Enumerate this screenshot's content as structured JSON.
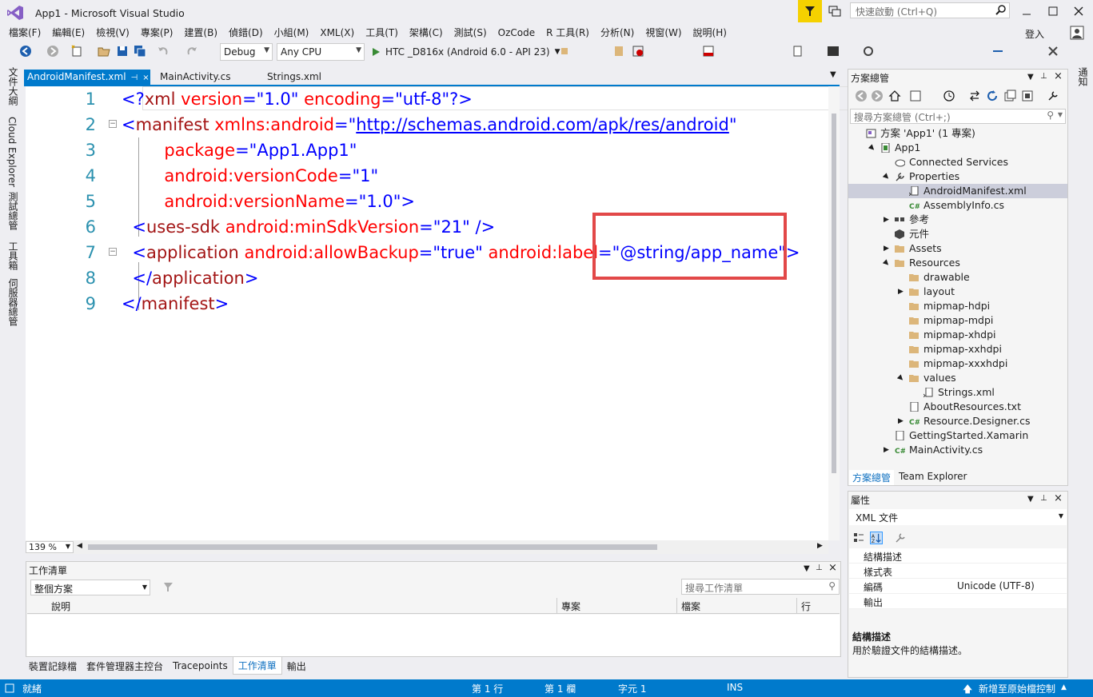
{
  "window": {
    "title": "App1 - Microsoft Visual Studio",
    "quick_launch_placeholder": "快速啟動 (Ctrl+Q)",
    "login": "登入"
  },
  "menu": [
    "檔案(F)",
    "編輯(E)",
    "檢視(V)",
    "專案(P)",
    "建置(B)",
    "偵錯(D)",
    "小組(M)",
    "XML(X)",
    "工具(T)",
    "架構(C)",
    "測試(S)",
    "OzCode",
    "R 工具(R)",
    "分析(N)",
    "視窗(W)",
    "說明(H)"
  ],
  "toolbar": {
    "config": "Debug",
    "platform": "Any CPU",
    "run_target": "HTC _D816x (Android 6.0 - API 23)"
  },
  "left_tabs": [
    "文件大綱",
    "Cloud Explorer",
    "測試總管",
    "工具箱",
    "伺服器總管"
  ],
  "right_tabs": [
    "通知"
  ],
  "doc_tabs": [
    "AndroidManifest.xml",
    "MainActivity.cs",
    "Strings.xml"
  ],
  "editor": {
    "lines": [
      {
        "n": "1",
        "fold": "",
        "parts": [
          [
            "<?",
            "blue"
          ],
          [
            "xml",
            "brown"
          ],
          [
            " version",
            "red"
          ],
          [
            "=",
            "blue"
          ],
          [
            "\"1.0\"",
            "black"
          ],
          [
            " encoding",
            "red"
          ],
          [
            "=",
            "blue"
          ],
          [
            "\"utf-8\"",
            "black"
          ],
          [
            "?>",
            "blue"
          ]
        ]
      },
      {
        "n": "2",
        "fold": "−",
        "parts": [
          [
            "<",
            "blue"
          ],
          [
            "manifest",
            "brown"
          ],
          [
            " xmlns:android",
            "red"
          ],
          [
            "=",
            "blue"
          ],
          [
            "\"",
            "black"
          ],
          [
            "http://schemas.android.com/apk/res/android",
            "link"
          ],
          [
            "\"",
            "black"
          ]
        ]
      },
      {
        "n": "3",
        "fold": "",
        "parts": [
          [
            "        package",
            "red"
          ],
          [
            "=",
            "blue"
          ],
          [
            "\"App1.App1\"",
            "black"
          ]
        ]
      },
      {
        "n": "4",
        "fold": "",
        "parts": [
          [
            "        android:versionCode",
            "red"
          ],
          [
            "=",
            "blue"
          ],
          [
            "\"1\"",
            "black"
          ]
        ]
      },
      {
        "n": "5",
        "fold": "",
        "parts": [
          [
            "        android:versionName",
            "red"
          ],
          [
            "=",
            "blue"
          ],
          [
            "\"1.0\"",
            "black"
          ],
          [
            ">",
            "blue"
          ]
        ]
      },
      {
        "n": "6",
        "fold": "",
        "parts": [
          [
            "  <",
            "blue"
          ],
          [
            "uses-sdk",
            "brown"
          ],
          [
            " android:minSdkVersion",
            "red"
          ],
          [
            "=",
            "blue"
          ],
          [
            "\"21\"",
            "black"
          ],
          [
            " />",
            "blue"
          ]
        ]
      },
      {
        "n": "7",
        "fold": "−",
        "parts": [
          [
            "  <",
            "blue"
          ],
          [
            "application",
            "brown"
          ],
          [
            " android:allowBackup",
            "red"
          ],
          [
            "=",
            "blue"
          ],
          [
            "\"true\"",
            "black"
          ],
          [
            " android:label",
            "red"
          ],
          [
            "=",
            "blue"
          ],
          [
            "\"@string/app_name\"",
            "black"
          ],
          [
            ">",
            "blue"
          ]
        ]
      },
      {
        "n": "8",
        "fold": "",
        "parts": [
          [
            "  </",
            "blue"
          ],
          [
            "application",
            "brown"
          ],
          [
            ">",
            "blue"
          ]
        ]
      },
      {
        "n": "9",
        "fold": "",
        "parts": [
          [
            "</",
            "blue"
          ],
          [
            "manifest",
            "brown"
          ],
          [
            ">",
            "blue"
          ]
        ]
      }
    ],
    "zoom": "139 %"
  },
  "task_list": {
    "title": "工作清單",
    "scope": "整個方案",
    "search_placeholder": "搜尋工作清單",
    "columns": [
      "說明",
      "專案",
      "檔案",
      "行"
    ]
  },
  "bottom_tabs": [
    "裝置記錄檔",
    "套件管理器主控台",
    "Tracepoints",
    "工作清單",
    "輸出"
  ],
  "status": {
    "ready": "就緒",
    "line": "第 1 行",
    "col": "第 1 欄",
    "char": "字元 1",
    "ins": "INS",
    "source_control": "新增至原始檔控制"
  },
  "solution_explorer": {
    "title": "方案總管",
    "search_placeholder": "搜尋方案總管 (Ctrl+;)",
    "items": [
      {
        "label": "方案 'App1' (1 專案)",
        "indent": 0,
        "arrow": "",
        "icon": "solution"
      },
      {
        "label": "App1",
        "indent": 1,
        "arrow": "▲",
        "icon": "project"
      },
      {
        "label": "Connected Services",
        "indent": 2,
        "arrow": "",
        "icon": "cloud"
      },
      {
        "label": "Properties",
        "indent": 2,
        "arrow": "▲",
        "icon": "wrench"
      },
      {
        "label": "AndroidManifest.xml",
        "indent": 3,
        "arrow": "",
        "icon": "xml"
      },
      {
        "label": "AssemblyInfo.cs",
        "indent": 3,
        "arrow": "",
        "icon": "cs"
      },
      {
        "label": "參考",
        "indent": 2,
        "arrow": "▶",
        "icon": "ref"
      },
      {
        "label": "元件",
        "indent": 2,
        "arrow": "",
        "icon": "component"
      },
      {
        "label": "Assets",
        "indent": 2,
        "arrow": "▶",
        "icon": "folder"
      },
      {
        "label": "Resources",
        "indent": 2,
        "arrow": "▲",
        "icon": "folder"
      },
      {
        "label": "drawable",
        "indent": 3,
        "arrow": "",
        "icon": "folder"
      },
      {
        "label": "layout",
        "indent": 3,
        "arrow": "▶",
        "icon": "folder"
      },
      {
        "label": "mipmap-hdpi",
        "indent": 3,
        "arrow": "",
        "icon": "folder"
      },
      {
        "label": "mipmap-mdpi",
        "indent": 3,
        "arrow": "",
        "icon": "folder"
      },
      {
        "label": "mipmap-xhdpi",
        "indent": 3,
        "arrow": "",
        "icon": "folder"
      },
      {
        "label": "mipmap-xxhdpi",
        "indent": 3,
        "arrow": "",
        "icon": "folder"
      },
      {
        "label": "mipmap-xxxhdpi",
        "indent": 3,
        "arrow": "",
        "icon": "folder"
      },
      {
        "label": "values",
        "indent": 3,
        "arrow": "▲",
        "icon": "folder"
      },
      {
        "label": "Strings.xml",
        "indent": 4,
        "arrow": "",
        "icon": "xml"
      },
      {
        "label": "AboutResources.txt",
        "indent": 3,
        "arrow": "",
        "icon": "txt"
      },
      {
        "label": "Resource.Designer.cs",
        "indent": 3,
        "arrow": "▶",
        "icon": "cs"
      },
      {
        "label": "GettingStarted.Xamarin",
        "indent": 2,
        "arrow": "",
        "icon": "txt"
      },
      {
        "label": "MainActivity.cs",
        "indent": 2,
        "arrow": "▶",
        "icon": "cs"
      }
    ],
    "selected_index": 4,
    "tabs": [
      "方案總管",
      "Team Explorer"
    ]
  },
  "properties": {
    "title": "屬性",
    "object": "XML 文件",
    "rows": [
      {
        "name": "結構描述",
        "value": ""
      },
      {
        "name": "樣式表",
        "value": ""
      },
      {
        "name": "編碼",
        "value": "Unicode (UTF-8)"
      },
      {
        "name": "輸出",
        "value": ""
      }
    ],
    "desc_title": "結構描述",
    "desc": "用於驗證文件的結構描述。"
  },
  "colors": {
    "accent": "#007acc",
    "highlight": "#e24848",
    "filter": "#f5d100"
  }
}
